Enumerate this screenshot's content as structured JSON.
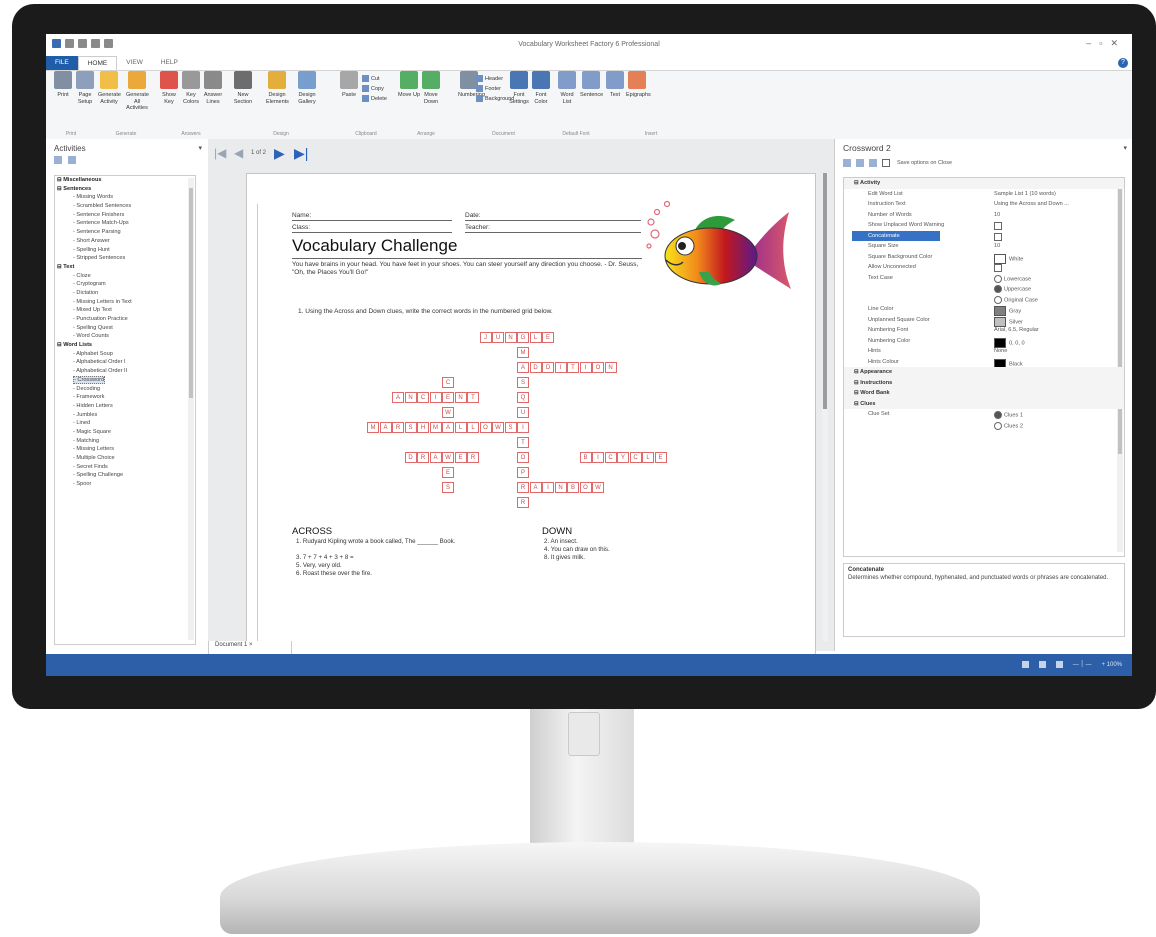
{
  "window": {
    "title": "Vocabulary Worksheet Factory 6 Professional"
  },
  "ribbon_tabs": [
    "FILE",
    "HOME",
    "VIEW",
    "HELP"
  ],
  "ribbon": {
    "buttons": [
      {
        "label": "Print",
        "icon": "printer-icon"
      },
      {
        "label": "Page Setup",
        "icon": "page-setup-icon"
      },
      {
        "label": "Generate Activity",
        "icon": "generate-icon"
      },
      {
        "label": "Generate All Activities",
        "icon": "generate-all-icon"
      },
      {
        "label": "Show Key",
        "icon": "checkmark-icon"
      },
      {
        "label": "Key Colors",
        "icon": "key-colors-icon"
      },
      {
        "label": "Answer Lines",
        "icon": "answer-lines-icon"
      },
      {
        "label": "New Section",
        "icon": "new-section-icon"
      },
      {
        "label": "Design Elements",
        "icon": "design-elements-icon"
      },
      {
        "label": "Design Gallery",
        "icon": "design-gallery-icon"
      },
      {
        "label": "Paste",
        "icon": "paste-icon"
      },
      {
        "label": "Move Up",
        "icon": "arrow-up-icon"
      },
      {
        "label": "Move Down",
        "icon": "arrow-down-icon"
      },
      {
        "label": "Numbering",
        "icon": "numbering-icon"
      },
      {
        "label": "Font Settings",
        "icon": "font-icon"
      },
      {
        "label": "Font Color",
        "icon": "font-color-icon"
      },
      {
        "label": "Word List",
        "icon": "word-list-icon"
      },
      {
        "label": "Sentence",
        "icon": "sentence-icon"
      },
      {
        "label": "Text",
        "icon": "text-icon"
      },
      {
        "label": "Epigraphs",
        "icon": "epigraphs-icon"
      }
    ],
    "small_buttons": [
      "Cut",
      "Copy",
      "Delete",
      "Header",
      "Footer",
      "Background"
    ],
    "groups": [
      "Print",
      "Generate",
      "Answers",
      "Design",
      "Clipboard",
      "Arrange",
      "Document",
      "Default Font",
      "Insert"
    ]
  },
  "activities_pane": {
    "title": "Activities",
    "categories": [
      {
        "name": "Miscellaneous",
        "items": []
      },
      {
        "name": "Sentences",
        "items": [
          "Missing Words",
          "Scrambled Sentences",
          "Sentence Finishers",
          "Sentence Match-Ups",
          "Sentence Parsing",
          "Short Answer",
          "Spelling Hunt",
          "Stripped Sentences"
        ]
      },
      {
        "name": "Text",
        "items": [
          "Cloze",
          "Cryptogram",
          "Dictation",
          "Missing Letters in Text",
          "Mixed Up Text",
          "Punctuation Practice",
          "Spelling Quest",
          "Word Counts"
        ]
      },
      {
        "name": "Word Lists",
        "items": [
          "Alphabet Soup",
          "Alphabetical Order I",
          "Alphabetical Order II",
          "Crossword",
          "Decoding",
          "Framework",
          "Hidden Letters",
          "Jumbles",
          "Lined",
          "Magic Square",
          "Matching",
          "Missing Letters",
          "Multiple Choice",
          "Secret Finds",
          "Spelling Challenge",
          "Spoor"
        ]
      }
    ],
    "selected_item": "Crossword"
  },
  "navigator": {
    "page": "1 of 2"
  },
  "worksheet": {
    "name_label": "Name:",
    "date_label": "Date:",
    "class_label": "Class:",
    "teacher_label": "Teacher:",
    "title": "Vocabulary Challenge",
    "quote": "You have brains in your head. You have feet in your shoes. You can steer yourself any direction you choose. - Dr. Seuss, \"Oh, the Places You'll Go!\"",
    "instruction": "1.  Using the Across and Down clues, write the correct words in the numbered grid below.",
    "across_heading": "ACROSS",
    "down_heading": "DOWN",
    "across_clues": [
      "1.  Rudyard Kipling wrote a book called, The ______ Book.",
      "3.  7 + 7 + 4 + 3 + 8 =",
      "5.  Very, very old.",
      "6.  Roast these over the fire."
    ],
    "down_clues": [
      "2.  An insect.",
      "4.  You can draw on this.",
      "8.  It gives milk."
    ]
  },
  "crossword": {
    "words": [
      {
        "text": "JUNGLE",
        "row": 0,
        "col": 9,
        "dir": "across"
      },
      {
        "text": "ADDITION",
        "row": 2,
        "col": 12,
        "dir": "across"
      },
      {
        "text": "ANCIENT",
        "row": 4,
        "col": 2,
        "dir": "across"
      },
      {
        "text": "MARSHMALLOWS",
        "row": 6,
        "col": 0,
        "dir": "across"
      },
      {
        "text": "DRAWER",
        "row": 8,
        "col": 3,
        "dir": "across"
      },
      {
        "text": "BICYCLE",
        "row": 8,
        "col": 17,
        "dir": "across"
      },
      {
        "text": "RAINBOW",
        "row": 10,
        "col": 12,
        "dir": "across"
      },
      {
        "text": "MOSQUITO",
        "row": 1,
        "col": 12,
        "dir": "down"
      },
      {
        "text": "COW",
        "row": 3,
        "col": 6,
        "dir": "down"
      },
      {
        "text": "PAPER",
        "row": 7,
        "col": 12,
        "dir": "down"
      },
      {
        "text": "YES",
        "row": 8,
        "col": 6,
        "dir": "down"
      }
    ]
  },
  "properties_pane": {
    "title": "Crossword 2",
    "toolbar_text": "Save options on Close",
    "rows": [
      {
        "type": "section",
        "name": "Activity"
      },
      {
        "name": "Edit Word List",
        "value": "Sample List 1 (10 words)"
      },
      {
        "name": "Instruction Text",
        "value": "Using the Across and Down ..."
      },
      {
        "name": "Number of Words",
        "value": "10"
      },
      {
        "name": "Show Unplaced Word Warning",
        "value": "",
        "check": true
      },
      {
        "name": "Concatenate",
        "value": "",
        "check": true,
        "selected": true
      },
      {
        "name": "Square Size",
        "value": "10"
      },
      {
        "name": "Square Background Color",
        "value": "White",
        "swatch": "#ffffff"
      },
      {
        "name": "Allow Unconnected",
        "value": "",
        "check": true
      },
      {
        "name": "Text Case",
        "value": "Lowercase",
        "radio": false
      },
      {
        "name": "",
        "value": "Uppercase",
        "radio": true
      },
      {
        "name": "",
        "value": "Original Case",
        "radio": false
      },
      {
        "name": "Line Color",
        "value": "Gray",
        "swatch": "#808080"
      },
      {
        "name": "Unplanned Square Color",
        "value": "Silver",
        "swatch": "#c0c0c0"
      },
      {
        "name": "Numbering Font",
        "value": "Arial, 6.5, Regular"
      },
      {
        "name": "Numbering Color",
        "value": "0, 0, 0",
        "swatch": "#000000"
      },
      {
        "name": "Hints",
        "value": "None"
      },
      {
        "name": "Hints Colour",
        "value": "Black",
        "swatch": "#000000"
      },
      {
        "type": "section",
        "name": "Appearance"
      },
      {
        "type": "section",
        "name": "Instructions"
      },
      {
        "type": "section",
        "name": "Word Bank"
      },
      {
        "type": "section",
        "name": "Clues"
      },
      {
        "name": "Clue Set",
        "value": "Clues 1",
        "radio": true
      },
      {
        "name": "",
        "value": "Clues 2",
        "radio": false
      }
    ],
    "description_title": "Concatenate",
    "description_text": "Determines whether compound, hyphenated, and punctuated words or phrases are concatenated."
  },
  "document_tab": "Document 1",
  "status_bar": {
    "zoom": "+ 100%"
  },
  "colors": {
    "accent": "#2c5fa8",
    "grid_cell": "#e06a6a",
    "selection": "#3572c6"
  }
}
